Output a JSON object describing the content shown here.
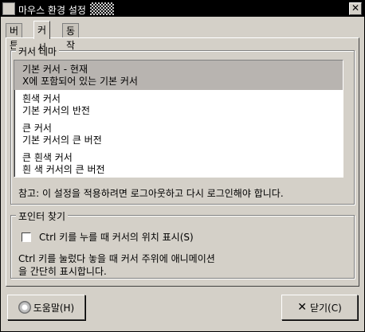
{
  "window": {
    "title": "마우스 환경 설정",
    "close_glyph": "✕"
  },
  "tabs": [
    {
      "label": "버튼"
    },
    {
      "label": "커서"
    },
    {
      "label": "동작"
    }
  ],
  "cursor_theme": {
    "group_label": "커서 테마",
    "items": [
      {
        "title": "기본 커서 - 현재",
        "subtitle": "X에 포함되어 있는 기본 커서",
        "selected": true
      },
      {
        "title": "흰색 커서",
        "subtitle": "기본 커서의 반전",
        "selected": false
      },
      {
        "title": "큰 커서",
        "subtitle": "기본 커서의 큰 버전",
        "selected": false
      },
      {
        "title": "큰 흰색 커서",
        "subtitle": "흰 색 커서의 큰 버전",
        "selected": false
      }
    ],
    "note": "참고: 이 설정을 적용하려면 로그아웃하고 다시 로그인해야 합니다."
  },
  "locate_pointer": {
    "group_label": "포인터 찾기",
    "checkbox_label": "Ctrl 키를 누를 때 커서의 위치 표시(S)",
    "checkbox_checked": false,
    "description_line1": "Ctrl 키를 눌렀다 놓을 때 커서 주위에 애니메이션",
    "description_line2": "을 간단히 표시합니다."
  },
  "buttons": {
    "help_label": "도움말(H)",
    "close_label": "닫기(C)"
  }
}
